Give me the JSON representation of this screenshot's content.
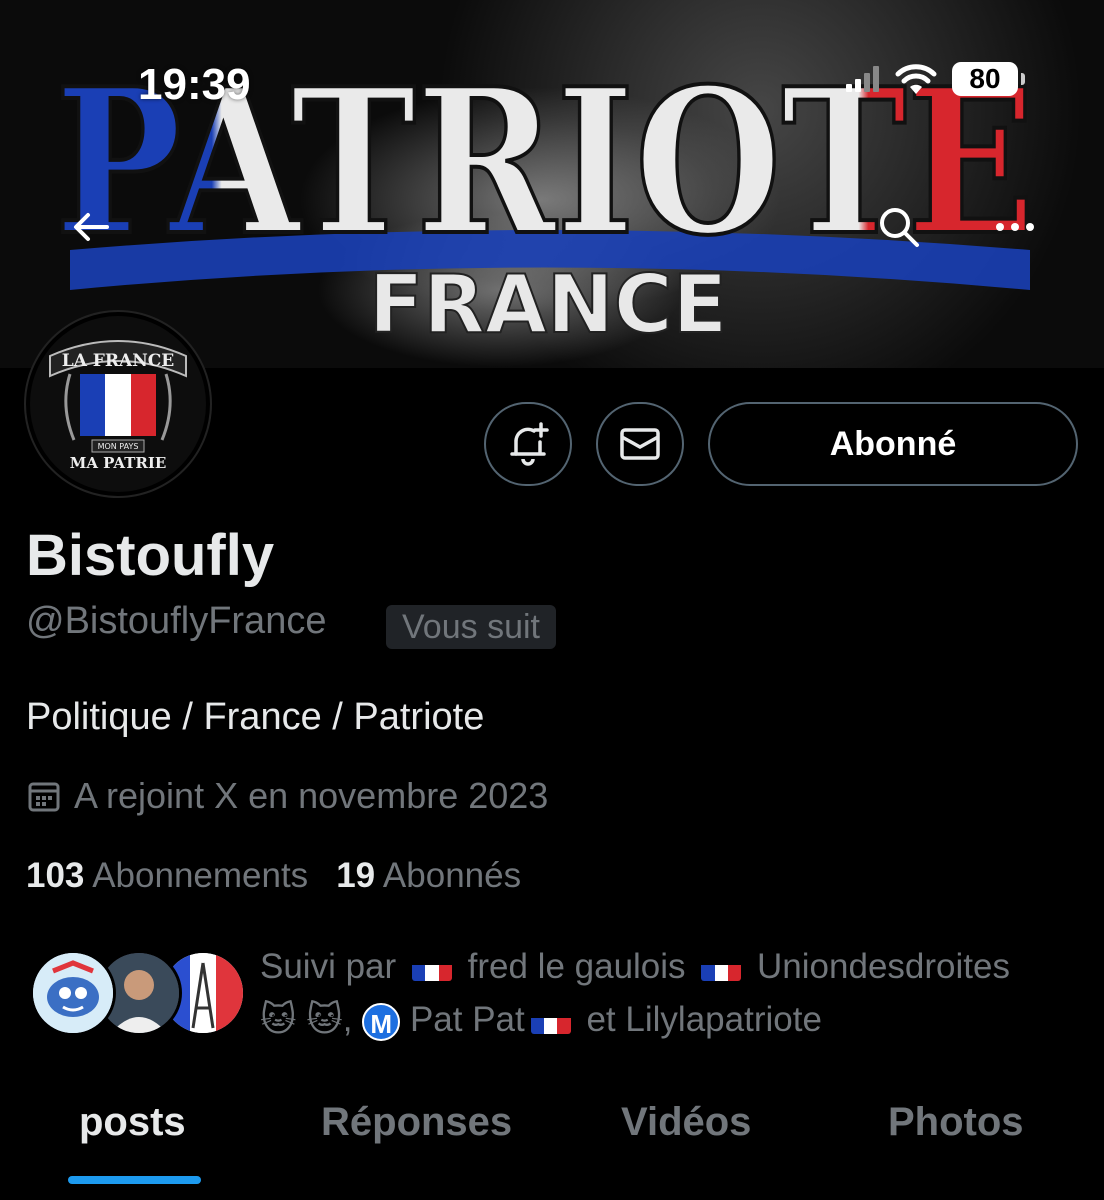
{
  "status_bar": {
    "time": "19:39",
    "battery": "80"
  },
  "banner": {
    "title": "PATRIOTE",
    "subtitle": "FRANCE"
  },
  "avatar": {
    "line1": "LA FRANCE",
    "line2": "MON PAYS",
    "line3": "MA PATRIE"
  },
  "actions": {
    "follow_label": "Abonné"
  },
  "profile": {
    "name": "Bistoufly",
    "handle": "@BistouflyFrance",
    "follows_you": "Vous suit",
    "bio": "Politique / France / Patriote",
    "joined": "A rejoint X en novembre 2023",
    "following_count": "103",
    "following_label": "Abonnements",
    "followers_count": "19",
    "followers_label": "Abonnés"
  },
  "followed_by": {
    "prefix": "Suivi par",
    "name1": "fred le gaulois",
    "name2": "Uniondesdroites",
    "cat_emoji": "🐱",
    "comma": ",",
    "badge_letter": "M",
    "name3": "Pat Pat",
    "conj": "et",
    "name4": "Lilylapatriote"
  },
  "tabs": [
    {
      "label": "posts"
    },
    {
      "label": "Réponses"
    },
    {
      "label": "Vidéos"
    },
    {
      "label": "Photos"
    }
  ],
  "colors": {
    "accent": "#1d9bf0",
    "flag_blue": "#1a3fb5",
    "flag_red": "#d7262d",
    "muted": "#71767b"
  }
}
